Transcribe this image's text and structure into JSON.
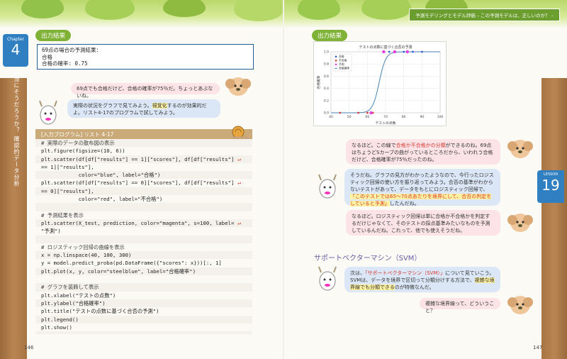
{
  "header_right": "予測モデリングとモデル評価 – この予測モデルは、正しいのか？ –",
  "chapter": {
    "label": "Chapter",
    "number": "4"
  },
  "vertical_title": "本当にそうだろうか？ 確認的データ分析",
  "lesson": {
    "label": "LESSON",
    "number": "19"
  },
  "left": {
    "section_label": "出力結果",
    "output_lines": [
      "69点の場合の予測結果：",
      "合格",
      "合格の確率: 0.75"
    ],
    "bubble1": "69点でも合格だけど、合格の確率が75％だ。ちょっとあぶないね。",
    "bubble2_pre": "実際の状況をグラフで見てみよう。",
    "bubble2_hl": "視覚化",
    "bubble2_post": "するのが効果的だよ。リスト4-17のプログラムで試してみよう。",
    "code_title": "[入力プログラム] リスト 4-17",
    "code": [
      {
        "t": "# 実際のデータの散布図の表示",
        "cls": "cmt"
      },
      {
        "t": "plt.figure(figsize=(10, 6))",
        "cls": ""
      },
      {
        "t": "plt.scatter(df[df[\"results\"] == 1][\"scores\"], df[df[\"results\"]",
        "cls": "",
        "ret": "↵"
      },
      {
        "t": "== 1][\"results\"],",
        "cls": ""
      },
      {
        "t": "            color=\"blue\", label=\"合格\")",
        "cls": ""
      },
      {
        "t": "plt.scatter(df[df[\"results\"] == 0][\"scores\"], df[df[\"results\"]",
        "cls": "",
        "ret": "↵"
      },
      {
        "t": "== 0][\"results\"],",
        "cls": ""
      },
      {
        "t": "            color=\"red\", label=\"不合格\")",
        "cls": ""
      },
      {
        "t": "",
        "cls": ""
      },
      {
        "t": "# 予測結果を表示",
        "cls": "cmt"
      },
      {
        "t": "plt.scatter(X_test, prediction, color=\"magenta\", s=100, label=",
        "cls": "",
        "ret": "↵"
      },
      {
        "t": "\"予測\")",
        "cls": ""
      },
      {
        "t": "",
        "cls": ""
      },
      {
        "t": "# ロジスティック回帰の曲線を表示",
        "cls": "cmt"
      },
      {
        "t": "x = np.linspace(40, 100, 300)",
        "cls": ""
      },
      {
        "t": "y = model.predict_proba(pd.DataFrame({\"scores\": x}))[:, 1]",
        "cls": ""
      },
      {
        "t": "plt.plot(x, y, color=\"steelblue\", label=\"合格確率\")",
        "cls": ""
      },
      {
        "t": "",
        "cls": ""
      },
      {
        "t": "# グラフを装飾して表示",
        "cls": "cmt"
      },
      {
        "t": "plt.xlabel(\"テストの点数\")",
        "cls": ""
      },
      {
        "t": "plt.ylabel(\"合格確率\")",
        "cls": ""
      },
      {
        "t": "plt.title(\"テストの点数に基づく合否の予測\")",
        "cls": ""
      },
      {
        "t": "plt.legend()",
        "cls": ""
      },
      {
        "t": "plt.show()",
        "cls": ""
      }
    ],
    "page_number": "146"
  },
  "right": {
    "section_label": "出力結果",
    "bubble1_pre": "なるほど。この線で",
    "bubble1_hl": "合格か不合格かの分類",
    "bubble1_post": "ができるのね。69点はちょうどSカーブの曲がっているところだから、いわれう合格だけど、合格確率が75％だったのね。",
    "bubble2_pre": "そうだね。グラフの見方がわかったようなので、今行ったロジスティック回帰の使い方を振り返ってみよう。合否の基準がわからないテストがあって、データをもとにロジスティック回帰で、",
    "bubble2_hl": "「このテストでは65～70点あたりを境界にして、合否の判定をしていると予測」",
    "bubble2_post": "したんだね。",
    "bubble3": "なるほど。ロジスティック回帰は単に合格か不合格かを判定するだけじゃなくて、そのテストの採点基準みたいなものを予測しているんだね。これって、他でも使えそうだね。",
    "heading": "サポートベクターマシン（SVM）",
    "bubble4_pre": "次は、",
    "bubble4_hl1": "「サポートベクターマシン（SVM）」",
    "bubble4_mid": "について見ていこう。SVMは、データを境界で区切って分類分けする方法で、",
    "bubble4_hl2": "複雑な境界線でも分類できる",
    "bubble4_post": "のが特徴なんだ。",
    "bubble5": "複雑な境界線って、どういうこと？",
    "page_number": "147"
  },
  "chart_data": {
    "type": "scatter",
    "title": "テストの点数に基づく合否の予測",
    "xlabel": "テストの点数",
    "ylabel": "合格確率",
    "xlim": [
      40,
      100
    ],
    "ylim": [
      0,
      1
    ],
    "xticks": [
      "40",
      "50",
      "60",
      "70",
      "80",
      "90",
      "100"
    ],
    "yticks": [
      "0.0",
      "0.2",
      "0.4",
      "0.6",
      "0.8",
      "1.0"
    ],
    "legend": [
      "合格",
      "不合格",
      "予測",
      "合格確率"
    ],
    "legend_position": "top-left",
    "series": [
      {
        "name": "合格",
        "x": [
          72,
          80,
          85,
          90
        ],
        "y": [
          1,
          1,
          1,
          1
        ],
        "color": "#2b5bd7"
      },
      {
        "name": "不合格",
        "x": [
          45,
          55,
          60,
          63
        ],
        "y": [
          0,
          0,
          0,
          0
        ],
        "color": "#d63a3a"
      },
      {
        "name": "予測",
        "x": [
          62,
          69,
          75,
          82
        ],
        "y": [
          0,
          1,
          1,
          1
        ],
        "color": "#e23ee0"
      }
    ],
    "curve": {
      "name": "合格確率",
      "color": "#4682b4",
      "midpoint": 66.5,
      "steepness": 0.55
    }
  }
}
